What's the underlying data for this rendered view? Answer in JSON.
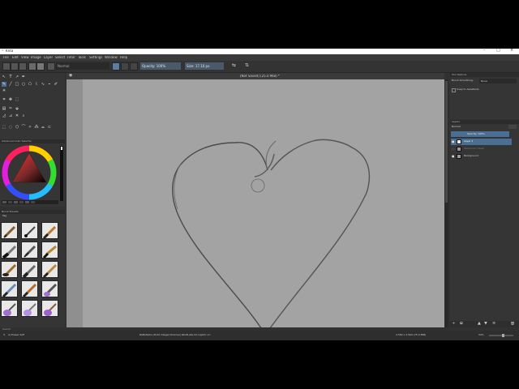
{
  "window": {
    "title": "Krita"
  },
  "menu": [
    "File",
    "Edit",
    "View",
    "Image",
    "Layer",
    "Select",
    "Filter",
    "Tools",
    "Settings",
    "Window",
    "Help"
  ],
  "toolbar": {
    "blend_mode": "Normal",
    "opacity": "Opacity: 100%",
    "size": "Size: 17.10 px"
  },
  "canvas": {
    "tab_title": "[Not Saved] (25.0 MiB) *"
  },
  "docker_left": {
    "color_selector_title": "Advanced Color Selector",
    "brush_presets_title": "Brush Presets",
    "brush_tag": "Tag",
    "brush_search": "Search"
  },
  "docker_right": {
    "tool_options_title": "Tool Options",
    "brush_smoothing_label": "Brush Smoothing:",
    "brush_smoothing_value": "None",
    "snap_label": "Snap to Assistants",
    "layers_title": "Layers",
    "layer_blend": "Normal",
    "layer_opacity": "Opacity: 100%",
    "layers": [
      {
        "name": "Layer 1",
        "selected": true,
        "thumb_color": "#e9e9e9"
      },
      {
        "name": "Watercolor Wash",
        "selected": false,
        "thumb_color": "#9a9a9a"
      },
      {
        "name": "Background",
        "selected": false,
        "thumb_color": "#9a9a9a"
      }
    ]
  },
  "status": {
    "brush": "a) Eraser Soft",
    "color_info": "RGB/Alpha (8-bit integer/channel)  sRGB-elle-V2-srgbtrc.icc",
    "dimensions": "2,560 x 2,560 (75.0 MiB)",
    "zoom": "34%"
  },
  "colors": {
    "canvas_bg": "#a3a3a3",
    "selection_blue": "#4a6f93",
    "ui_dark": "#313131"
  }
}
